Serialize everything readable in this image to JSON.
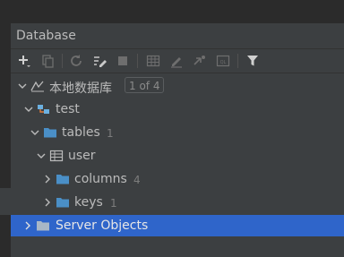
{
  "window": {
    "title": "Database"
  },
  "toolbar": {
    "icons": [
      "add-icon",
      "copy-icon",
      "refresh-icon",
      "edit-properties-icon",
      "stop-icon",
      "table-icon",
      "edit-icon",
      "jump-icon",
      "sql-console-icon",
      "filter-icon"
    ]
  },
  "tree": {
    "root": {
      "label": "本地数据库",
      "badge": "1 of 4"
    },
    "schema": {
      "label": "test"
    },
    "tables": {
      "label": "tables",
      "count": "1"
    },
    "table": {
      "label": "user"
    },
    "columns": {
      "label": "columns",
      "count": "4"
    },
    "keys": {
      "label": "keys",
      "count": "1"
    },
    "server_objects": {
      "label": "Server Objects"
    }
  },
  "colors": {
    "panel": "#3c3f41",
    "selection": "#2f65ca",
    "folder": "#4a8fc7",
    "schema": "#6bb0e0",
    "schema_accent": "#e07b3c"
  }
}
